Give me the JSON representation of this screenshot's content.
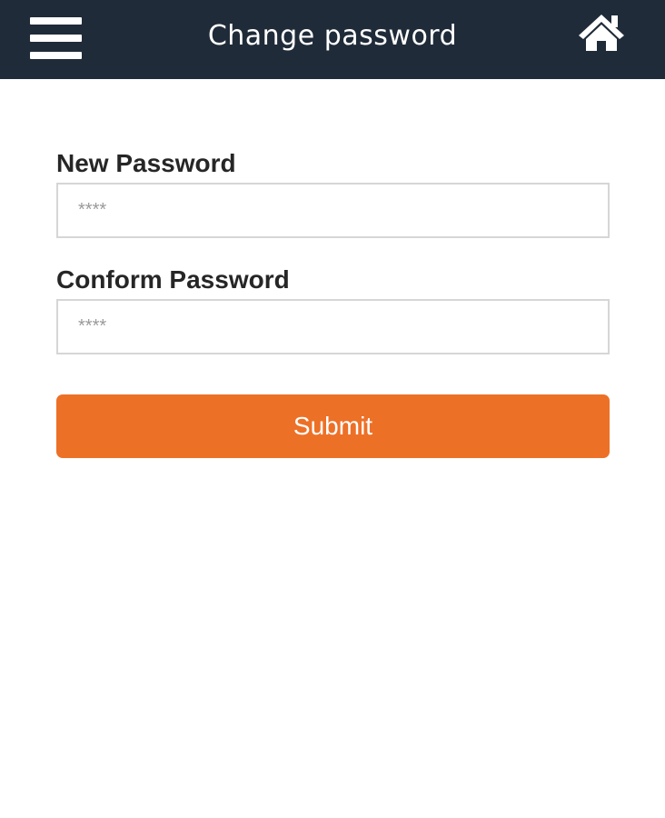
{
  "header": {
    "title": "Change password",
    "menu_icon": "hamburger-menu-icon",
    "home_icon": "home-icon",
    "background_color": "#1f2b38"
  },
  "form": {
    "new_password": {
      "label": "New Password",
      "placeholder": "****",
      "value": ""
    },
    "confirm_password": {
      "label": "Conform Password",
      "placeholder": "****",
      "value": ""
    },
    "submit_label": "Submit",
    "submit_color": "#ed7027"
  }
}
